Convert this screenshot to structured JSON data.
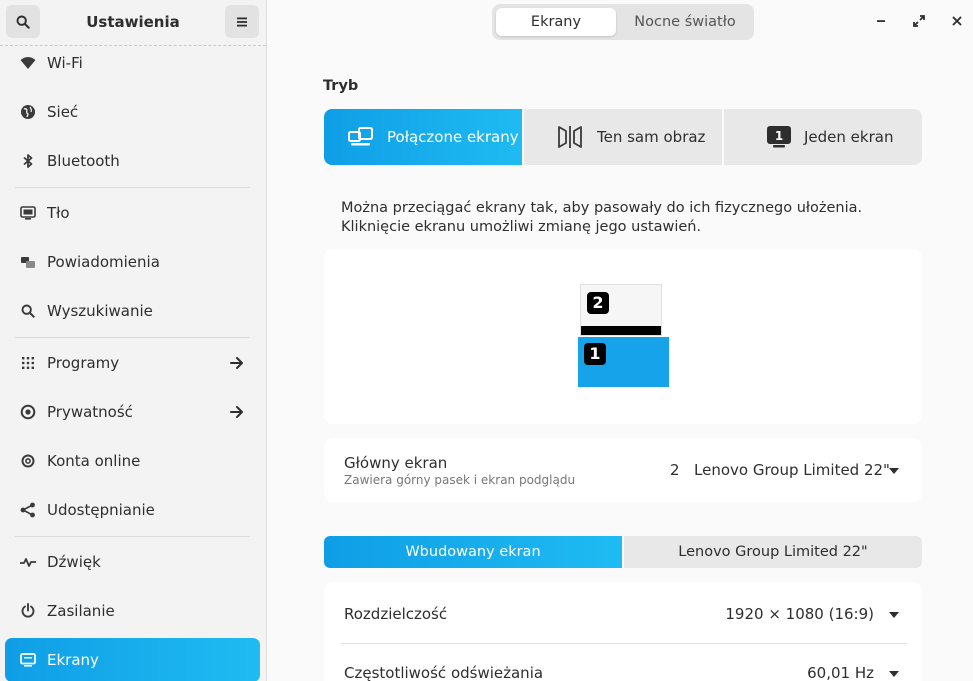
{
  "sidebar": {
    "title": "Ustawienia",
    "search_icon": "search-icon",
    "menu_icon": "hamburger-menu-icon",
    "items": [
      {
        "label": "Wi-Fi",
        "icon": "wifi-icon"
      },
      {
        "label": "Sieć",
        "icon": "network-globe-icon"
      },
      {
        "label": "Bluetooth",
        "icon": "bluetooth-icon"
      },
      {
        "label": "Tło",
        "icon": "background-icon"
      },
      {
        "label": "Powiadomienia",
        "icon": "notifications-icon"
      },
      {
        "label": "Wyszukiwanie",
        "icon": "search-icon"
      },
      {
        "label": "Programy",
        "icon": "apps-grid-icon"
      },
      {
        "label": "Prywatność",
        "icon": "privacy-hand-icon"
      },
      {
        "label": "Konta online",
        "icon": "online-accounts-icon"
      },
      {
        "label": "Udostępnianie",
        "icon": "share-icon"
      },
      {
        "label": "Dźwięk",
        "icon": "sound-icon"
      },
      {
        "label": "Zasilanie",
        "icon": "power-icon"
      },
      {
        "label": "Ekrany",
        "icon": "displays-icon"
      }
    ],
    "active": "Ekrany"
  },
  "header": {
    "tabs": [
      "Ekrany",
      "Nocne światło"
    ],
    "selected_tab": "Ekrany"
  },
  "mode": {
    "title": "Tryb",
    "options": [
      {
        "label": "Połączone ekrany",
        "icon": "joined-displays-icon"
      },
      {
        "label": "Ten sam obraz",
        "icon": "mirror-icon"
      },
      {
        "label": "Jeden ekran",
        "icon": "single-display-icon"
      }
    ],
    "selected": "Połączone ekrany"
  },
  "arrangement": {
    "description": "Można przeciągać ekrany tak, aby pasowały do ich fizycznego ułożenia. Kliknięcie ekranu umożliwi zmianę jego ustawień.",
    "display_numbers": [
      "2",
      "1"
    ]
  },
  "primary": {
    "label": "Główny ekran",
    "sublabel": "Zawiera górny pasek i ekran podglądu",
    "number": "2",
    "value": "Lenovo Group Limited 22\""
  },
  "display_tabs": {
    "items": [
      "Wbudowany ekran",
      "Lenovo Group Limited 22\""
    ],
    "selected": "Wbudowany ekran"
  },
  "settings": {
    "resolution_label": "Rozdzielczość",
    "resolution_value": "1920 × 1080 (16:9)",
    "refresh_label": "Częstotliwość odświeżania",
    "refresh_value": "60,01 Hz"
  },
  "colors": {
    "accent": "#16a3ea",
    "sidebar_bg": "#f3f3f3",
    "content_bg": "#fafafa"
  }
}
